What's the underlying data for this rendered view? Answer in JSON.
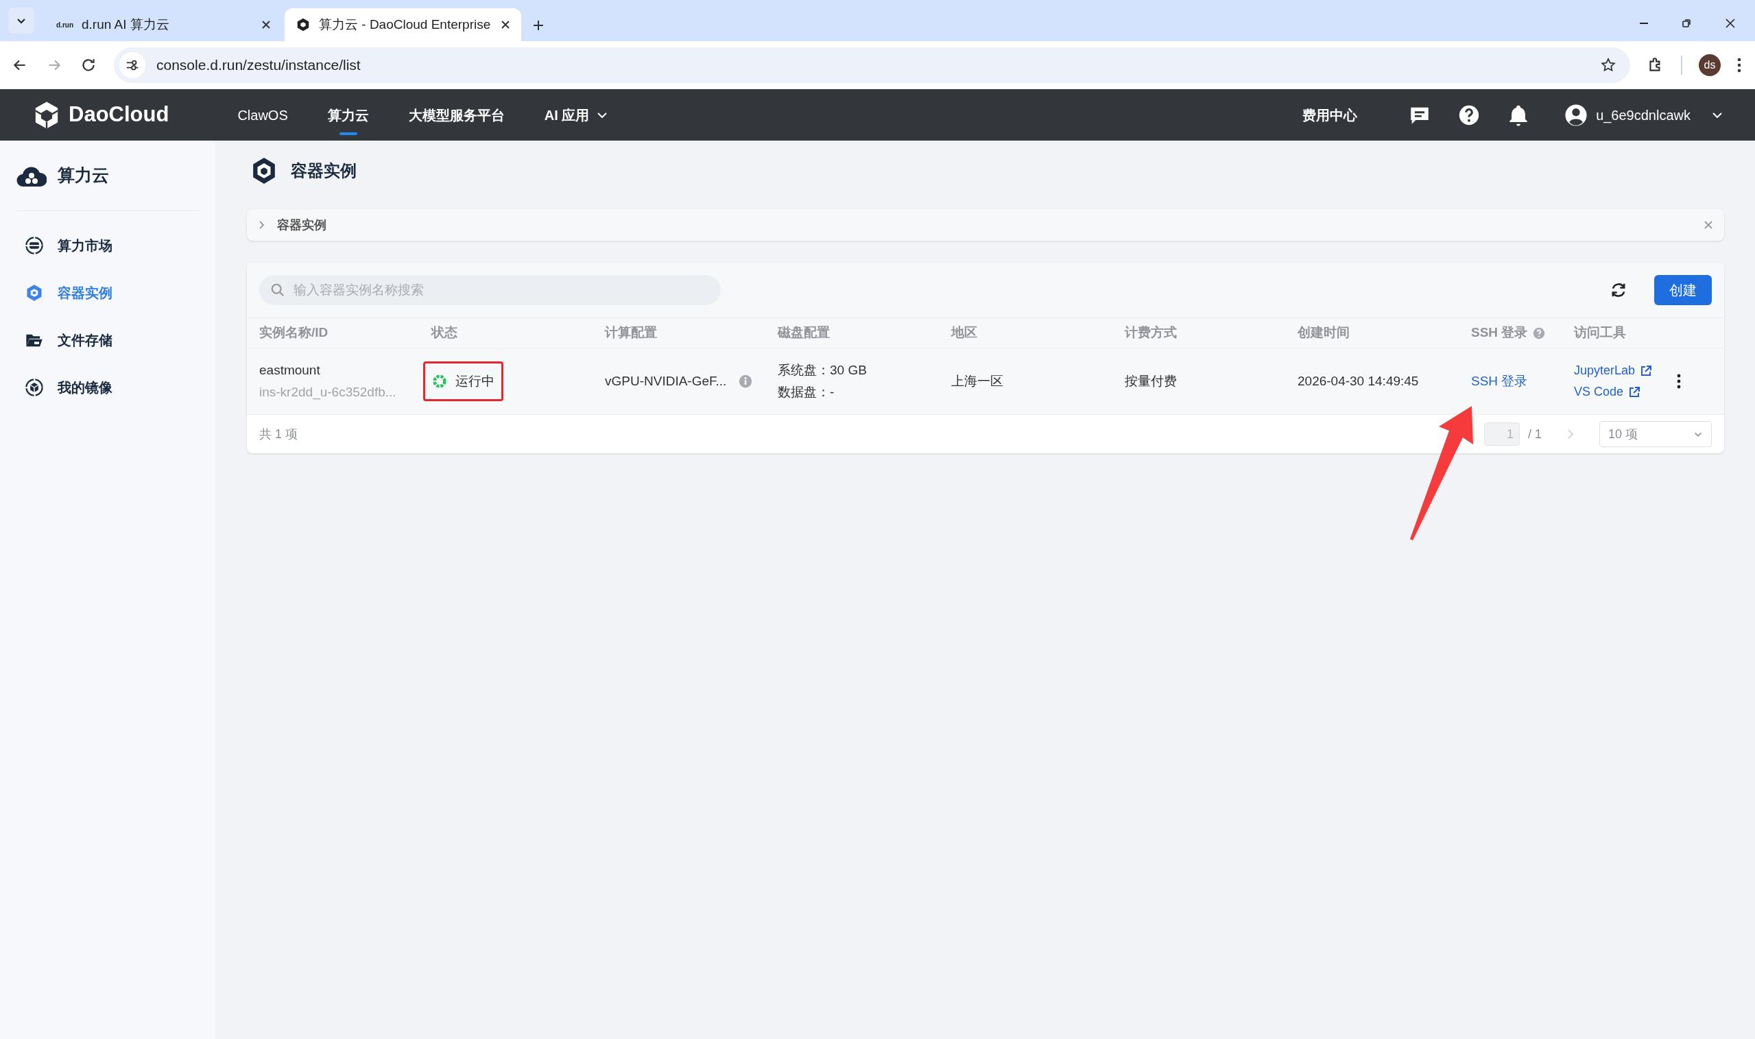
{
  "browser": {
    "tabs": [
      {
        "favicon": "d.run",
        "title": "d.run AI 算力云",
        "selected": false
      },
      {
        "title": "算力云 - DaoCloud Enterprise",
        "selected": true
      }
    ],
    "url": "console.d.run/zestu/instance/list",
    "profile": "ds"
  },
  "header": {
    "logo": "DaoCloud",
    "nav": [
      {
        "label": "ClawOS",
        "selected": false,
        "dropdown": false
      },
      {
        "label": "算力云",
        "selected": true,
        "dropdown": false
      },
      {
        "label": "大模型服务平台",
        "selected": false,
        "dropdown": false
      },
      {
        "label": "AI 应用",
        "selected": false,
        "dropdown": true
      }
    ],
    "billing": "费用中心",
    "username": "u_6e9cdnlcawk"
  },
  "sidebar": {
    "title": "算力云",
    "items": [
      {
        "label": "算力市场",
        "kind": "market",
        "selected": false
      },
      {
        "label": "容器实例",
        "kind": "instance",
        "selected": true
      },
      {
        "label": "文件存储",
        "kind": "storage",
        "selected": false
      },
      {
        "label": "我的镜像",
        "kind": "image",
        "selected": false
      }
    ]
  },
  "page_title": "容器实例",
  "breadcrumb": "容器实例",
  "search": {
    "placeholder": "输入容器实例名称搜索"
  },
  "create_button": "创建",
  "table": {
    "columns": [
      {
        "label": "实例名称/ID"
      },
      {
        "label": "状态"
      },
      {
        "label": "计算配置"
      },
      {
        "label": "磁盘配置"
      },
      {
        "label": "地区"
      },
      {
        "label": "计费方式"
      },
      {
        "label": "创建时间"
      },
      {
        "label": "SSH 登录",
        "help": true
      },
      {
        "label": "访问工具"
      }
    ],
    "rows": [
      {
        "name": "eastmount",
        "id": "ins-kr2dd_u-6c352dfb...",
        "status": "运行中",
        "status_highlighted": true,
        "compute": "vGPU-NVIDIA-GeF...",
        "disk_system": "系统盘：30 GB",
        "disk_data": "数据盘：-",
        "region": "上海一区",
        "billing": "按量付费",
        "created": "2026-04-30 14:49:45",
        "ssh": "SSH 登录",
        "tools": [
          "JupyterLab",
          "VS Code"
        ]
      }
    ]
  },
  "pagination": {
    "total": "共 1 项",
    "page": "1",
    "pages": "/ 1",
    "page_size": "10 项"
  },
  "annotations": [
    {
      "kind": "arrow"
    }
  ]
}
